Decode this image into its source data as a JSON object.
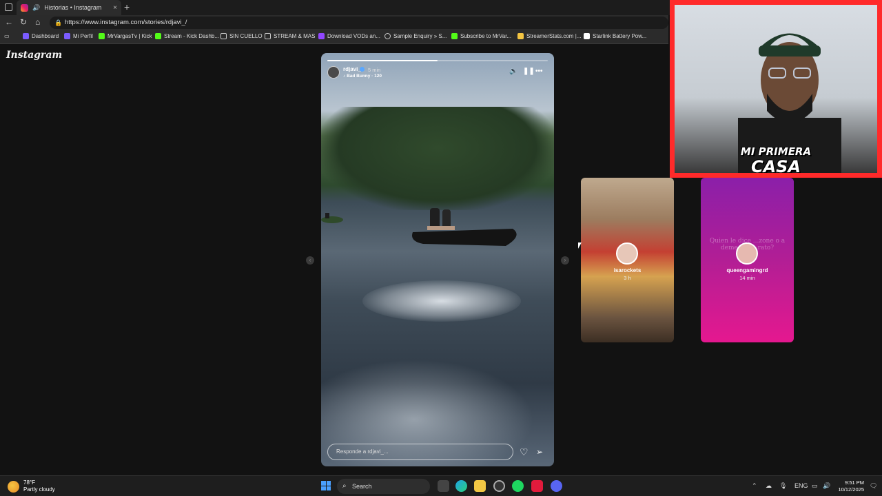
{
  "browser": {
    "tab_title": "Historias • Instagram",
    "tab_close": "×",
    "new_tab": "+",
    "url": "https://www.instagram.com/stories/rdjavi_/"
  },
  "bookmarks": [
    {
      "label": "Dashboard",
      "color": "#7b5cff"
    },
    {
      "label": "Mi Perfil",
      "color": "#7b5cff"
    },
    {
      "label": "MrVargasTv | Kick",
      "color": "#53fc18"
    },
    {
      "label": "Stream - Kick Dashb...",
      "color": "#53fc18"
    },
    {
      "label": "SIN CUELLO",
      "color": "folder"
    },
    {
      "label": "STREAM & MAS",
      "color": "folder"
    },
    {
      "label": "Download VODs an...",
      "color": "#9146ff"
    },
    {
      "label": "Sample Enquiry » S...",
      "color": "globe"
    },
    {
      "label": "Subscribe to MrVar...",
      "color": "#53fc18"
    },
    {
      "label": "StreamerStats.com |...",
      "color": "#f4c542"
    },
    {
      "label": "Starlink Battery Pow...",
      "color": "#ffffff"
    }
  ],
  "instagram": {
    "logo": "Instagram",
    "story": {
      "username": "rdjavi_",
      "time_ago": "5 min",
      "music": "Bad Bunny · 120",
      "progress": 0.5,
      "reply_placeholder": "Responde a rdjavi_..."
    },
    "previews": [
      {
        "username": "isarockets",
        "time_ago": "3 h",
        "text": ""
      },
      {
        "username": "queengamingrd",
        "time_ago": "14 min",
        "text": "Quien le dice ...zone o a deme... ...n rato?"
      }
    ]
  },
  "webcam": {
    "overlay_line1": "MI PRIMERA",
    "overlay_line2": "CASA",
    "border_color": "#ff2a2a"
  },
  "taskbar": {
    "weather_temp": "78°F",
    "weather_desc": "Partly cloudy",
    "search_label": "Search",
    "language": "ENG",
    "time": "9:51 PM",
    "date": "10/12/2025"
  }
}
